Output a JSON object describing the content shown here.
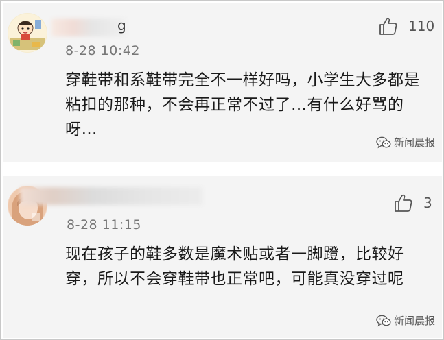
{
  "comments": [
    {
      "username_visible": "g",
      "timestamp": "8-28 10:42",
      "likes": "110",
      "text": "穿鞋带和系鞋带完全不一样好吗，小学生大多都是粘扣的那种，不会再正常不过了…有什么好骂的呀…",
      "watermark": "新闻晨报",
      "avatar_icon": "cartoon-avatar-icon",
      "like_icon": "thumbs-up-icon"
    },
    {
      "username_visible": "",
      "timestamp": "8-28 11:15",
      "likes": "3",
      "text": "现在孩子的鞋多数是魔术贴或者一脚蹬，比较好穿，所以不会穿鞋带也正常吧，可能真没穿过呢",
      "watermark": "新闻晨报",
      "avatar_icon": "portrait-avatar-icon",
      "like_icon": "thumbs-up-icon"
    }
  ],
  "colors": {
    "card_bg": "#f4f4f4",
    "text": "#1a1a1a",
    "meta": "#777777"
  }
}
